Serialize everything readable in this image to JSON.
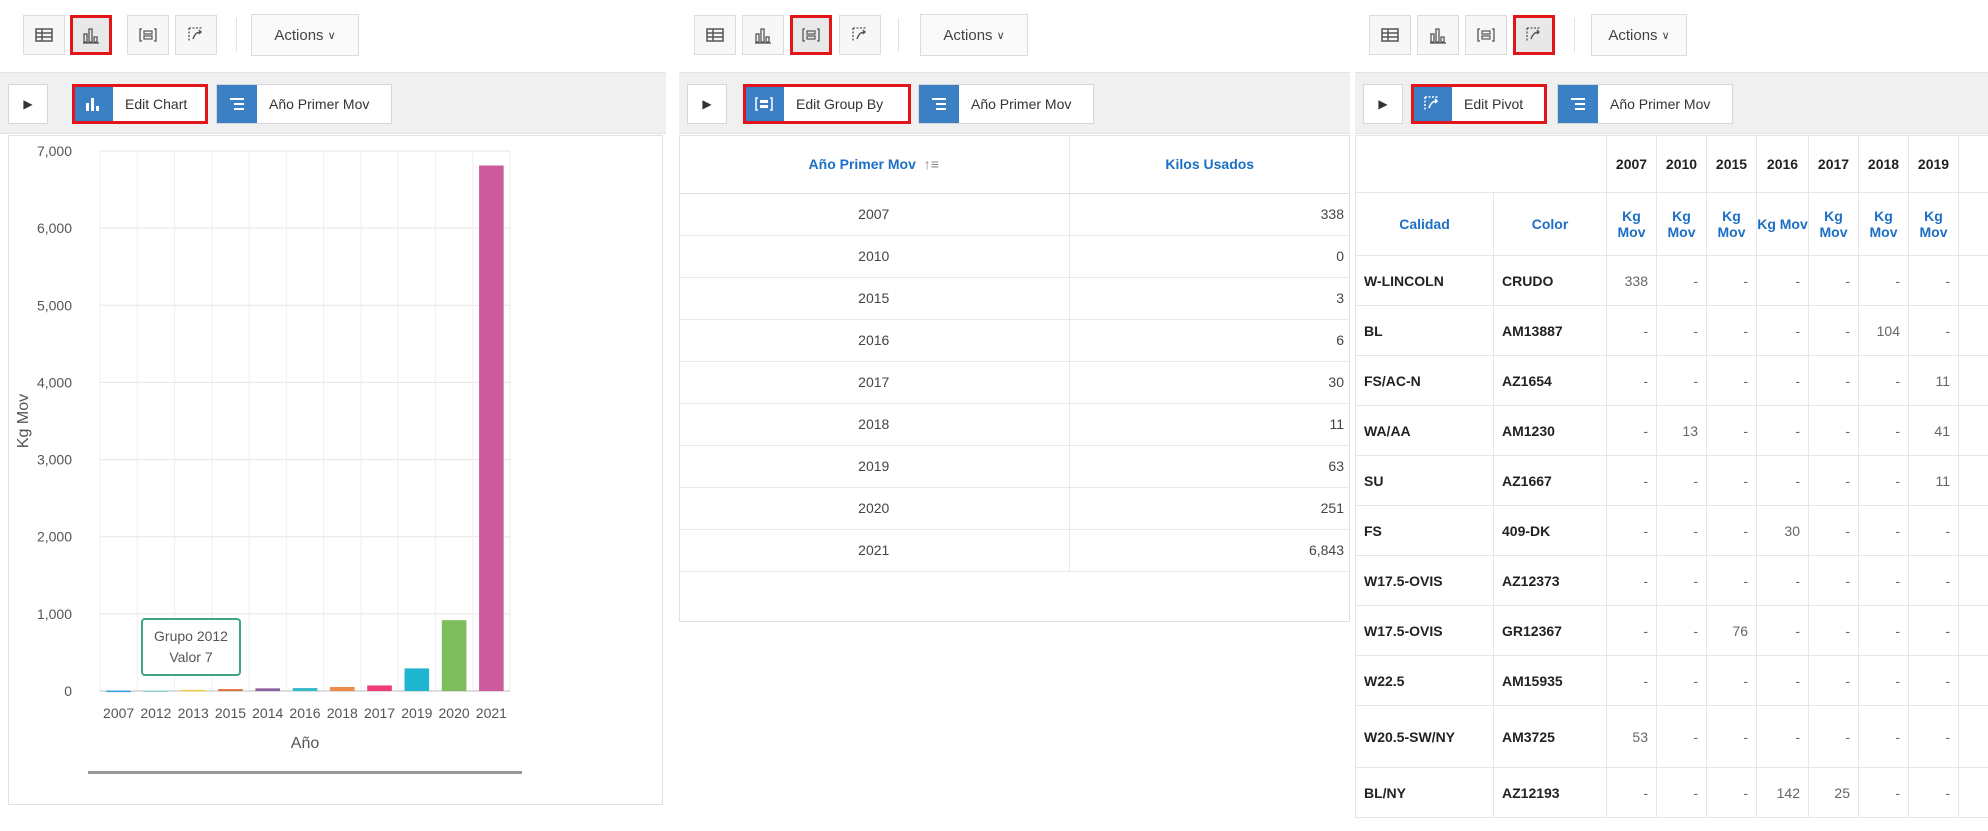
{
  "toolbar": {
    "actions_label": "Actions"
  },
  "icons": [
    "grid-icon",
    "chart-icon",
    "group-by-icon",
    "pivot-icon"
  ],
  "panel_chart": {
    "edit_label": "Edit Chart",
    "filter_label": "Año Primer Mov",
    "chart_data": {
      "type": "bar",
      "categories": [
        "2007",
        "2012",
        "2013",
        "2015",
        "2014",
        "2016",
        "2018",
        "2017",
        "2019",
        "2020",
        "2021"
      ],
      "values": [
        5,
        7,
        14,
        25,
        34,
        38,
        52,
        72,
        293,
        918,
        6812
      ],
      "colors": [
        "#309fdb",
        "#8ed3d2",
        "#eac93e",
        "#e1713c",
        "#8b5d9c",
        "#37b9c6",
        "#ec8a4a",
        "#ec3a7a",
        "#1fb4d0",
        "#7ebc5c",
        "#cc5a9c"
      ],
      "xlabel": "Año",
      "ylabel": "Kg Mov",
      "ylim": [
        0,
        7000
      ],
      "yticks": [
        "0",
        "1,000",
        "2,000",
        "3,000",
        "4,000",
        "5,000",
        "6,000",
        "7,000"
      ],
      "grid": true,
      "tooltip": {
        "line1": "Grupo 2012",
        "line2": "Valor 7"
      }
    }
  },
  "panel_group": {
    "edit_label": "Edit Group By",
    "filter_label": "Año Primer Mov",
    "col1": "Año Primer Mov",
    "col2": "Kilos Usados",
    "rows": [
      [
        "2007",
        "338"
      ],
      [
        "2010",
        "0"
      ],
      [
        "2015",
        "3"
      ],
      [
        "2016",
        "6"
      ],
      [
        "2017",
        "30"
      ],
      [
        "2018",
        "11"
      ],
      [
        "2019",
        "63"
      ],
      [
        "2020",
        "251"
      ],
      [
        "2021",
        "6,843"
      ]
    ]
  },
  "panel_pivot": {
    "edit_label": "Edit Pivot",
    "filter_label": "Año Primer Mov",
    "years": [
      "2007",
      "2010",
      "2015",
      "2016",
      "2017",
      "2018",
      "2019"
    ],
    "col_calidad": "Calidad",
    "col_color": "Color",
    "measure": "Kg Mov",
    "rows": [
      [
        "W-LINCOLN",
        "CRUDO",
        "338",
        "-",
        "-",
        "-",
        "-",
        "-",
        "-"
      ],
      [
        "BL",
        "AM13887",
        "-",
        "-",
        "-",
        "-",
        "-",
        "104",
        "-"
      ],
      [
        "FS/AC-N",
        "AZ1654",
        "-",
        "-",
        "-",
        "-",
        "-",
        "-",
        "11"
      ],
      [
        "WA/AA",
        "AM1230",
        "-",
        "13",
        "-",
        "-",
        "-",
        "-",
        "41"
      ],
      [
        "SU",
        "AZ1667",
        "-",
        "-",
        "-",
        "-",
        "-",
        "-",
        "11"
      ],
      [
        "FS",
        "409-DK",
        "-",
        "-",
        "-",
        "30",
        "-",
        "-",
        "-"
      ],
      [
        "W17.5-OVIS",
        "AZ12373",
        "-",
        "-",
        "-",
        "-",
        "-",
        "-",
        "-"
      ],
      [
        "W17.5-OVIS",
        "GR12367",
        "-",
        "-",
        "76",
        "-",
        "-",
        "-",
        "-"
      ],
      [
        "W22.5",
        "AM15935",
        "-",
        "-",
        "-",
        "-",
        "-",
        "-",
        "-"
      ],
      [
        "W20.5-SW/NY",
        "AM3725",
        "53",
        "-",
        "-",
        "-",
        "-",
        "-",
        "-"
      ],
      [
        "BL/NY",
        "AZ12193",
        "-",
        "-",
        "-",
        "142",
        "25",
        "-",
        "-"
      ]
    ]
  }
}
